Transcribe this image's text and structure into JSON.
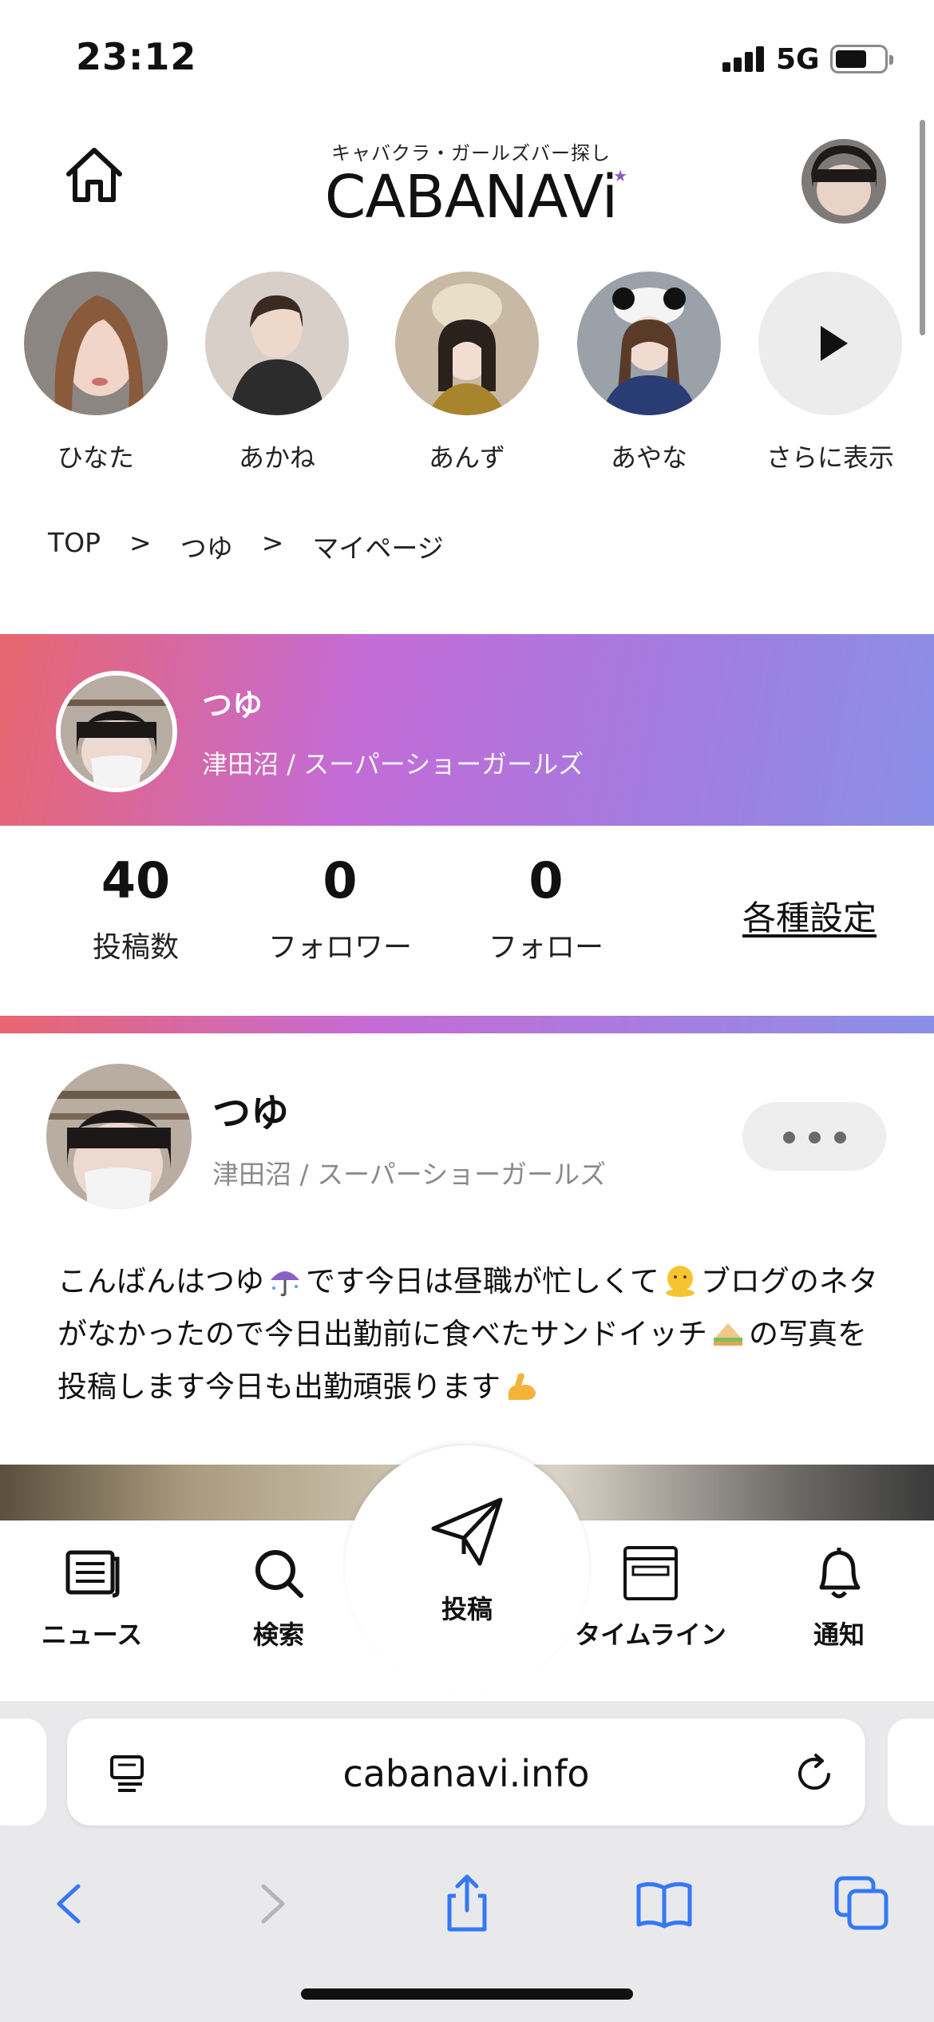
{
  "status_bar": {
    "time": "23:12",
    "network": "5G"
  },
  "header": {
    "tagline": "キャバクラ・ガールズバー探し",
    "logo_text": "CABANAVi"
  },
  "stories": [
    {
      "name": "ひなた"
    },
    {
      "name": "あかね"
    },
    {
      "name": "あんず"
    },
    {
      "name": "あやな"
    }
  ],
  "stories_more_label": "さらに表示",
  "breadcrumb": [
    "TOP",
    ">",
    "つゆ",
    ">",
    "マイページ"
  ],
  "profile": {
    "name": "つゆ",
    "location_shop": "津田沼 / スーパーショーガールズ",
    "stats": [
      {
        "value": "40",
        "label": "投稿数"
      },
      {
        "value": "0",
        "label": "フォロワー"
      },
      {
        "value": "0",
        "label": "フォロー"
      }
    ],
    "settings_label": "各種設定"
  },
  "post": {
    "author": "つゆ",
    "author_sub": "津田沼 / スーパーショーガールズ",
    "text_parts": [
      "こんばんはつゆ",
      "です今日は昼職が忙しくて",
      "ブログのネタがなかったので今日出勤前に食べたサンドイッチ",
      "の写真を投稿します今日も出勤頑張ります"
    ]
  },
  "app_nav": [
    {
      "label": "ニュース",
      "icon": "news-icon"
    },
    {
      "label": "検索",
      "icon": "search-icon"
    },
    {
      "label": "投稿",
      "icon": "paper-plane-icon"
    },
    {
      "label": "タイムライン",
      "icon": "timeline-icon"
    },
    {
      "label": "通知",
      "icon": "bell-icon"
    }
  ],
  "browser": {
    "url": "cabanavi.info"
  },
  "colors": {
    "gradient_start": "#e8666e",
    "gradient_mid": "#c46bd6",
    "gradient_end": "#8a8fe6",
    "browser_blue": "#3478f6"
  }
}
